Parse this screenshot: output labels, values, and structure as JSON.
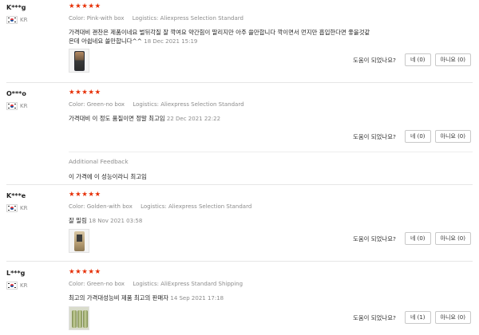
{
  "reviews": [
    {
      "user": "K***g",
      "country": "KR",
      "stars": "★★★★★",
      "color_label": "Color:",
      "color": "Pink-with box",
      "logistics_label": "Logistics:",
      "logistics": "Aliexpress Selection Standard",
      "text_line1": "가격대비 괜찬은 제품이네요 벌뒤각질 잘 깍여요 약간힘이 딸리지만 아주 쓸만합니다 깍이면서 먼지만 흡입한다면 좋을것같",
      "text_line2": "은데 아쉽네요 쓸만합니다^^",
      "date": "18 Dec 2021 15:19",
      "helpful_q": "도움이 되었나요?",
      "yes": "네 (0)",
      "no": "아니요 (0)"
    },
    {
      "user": "O***o",
      "country": "KR",
      "stars": "★★★★★",
      "color_label": "Color:",
      "color": "Green-no box",
      "logistics_label": "Logistics:",
      "logistics": "Aliexpress Selection Standard",
      "text": "가격대비 이 정도 품질이면 정말 최고임",
      "date": "22 Dec 2021 22:22",
      "helpful_q": "도움이 되었나요?",
      "yes": "네 (0)",
      "no": "아니요 (0)",
      "additional_title": "Additional Feedback",
      "additional_text": "이 가격에 이 성능이라니 최고임"
    },
    {
      "user": "K***e",
      "country": "KR",
      "stars": "★★★★★",
      "color_label": "Color:",
      "color": "Golden-with box",
      "logistics_label": "Logistics:",
      "logistics": "Aliexpress Selection Standard",
      "text": "잘 밀림",
      "date": "18 Nov 2021 03:58",
      "helpful_q": "도움이 되었나요?",
      "yes": "네 (0)",
      "no": "아니요 (0)"
    },
    {
      "user": "L***g",
      "country": "KR",
      "stars": "★★★★★",
      "color_label": "Color:",
      "color": "Green-no box",
      "logistics_label": "Logistics:",
      "logistics": "AliExpress Standard Shipping",
      "text": "최고의 가격대성능비 제품 최고의 판매자",
      "date": "14 Sep 2021 17:18",
      "helpful_q": "도움이 되었나요?",
      "yes": "네 (1)",
      "no": "아니요 (0)"
    }
  ],
  "colors": {
    "star": "#e62e04",
    "muted": "#8c8c8c",
    "divider": "#e6e6e6"
  }
}
